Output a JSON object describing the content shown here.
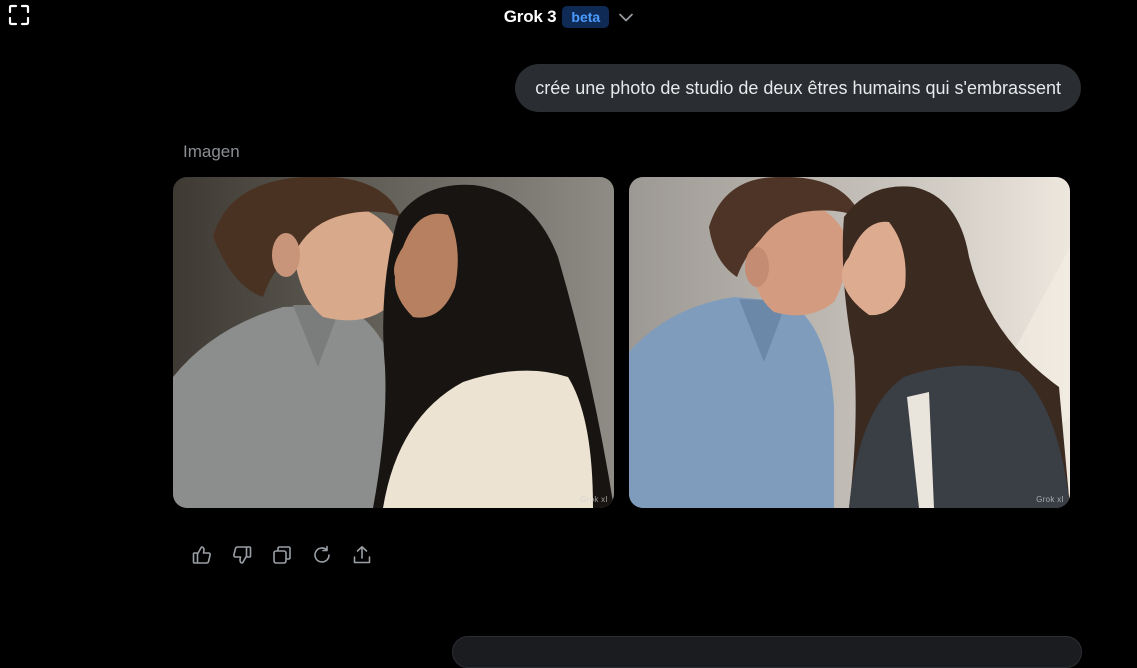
{
  "header": {
    "model_name": "Grok 3",
    "badge": "beta",
    "icons": {
      "fullscreen": "fullscreen-icon",
      "dropdown": "chevron-down-icon"
    }
  },
  "conversation": {
    "user_message": "crée une photo de studio de deux êtres humains qui s'embrassent",
    "response_label": "Imagen",
    "images": [
      {
        "watermark": "Grok xI"
      },
      {
        "watermark": "Grok xI"
      }
    ],
    "actions": [
      {
        "icon": "thumbs-up-icon"
      },
      {
        "icon": "thumbs-down-icon"
      },
      {
        "icon": "copy-icon"
      },
      {
        "icon": "regenerate-icon"
      },
      {
        "icon": "share-icon"
      }
    ]
  },
  "colors": {
    "background": "#000000",
    "user_bubble": "#2a2d31",
    "badge_bg": "#0f2a55",
    "badge_text": "#4c9bff",
    "muted_text": "#8b8f94"
  }
}
